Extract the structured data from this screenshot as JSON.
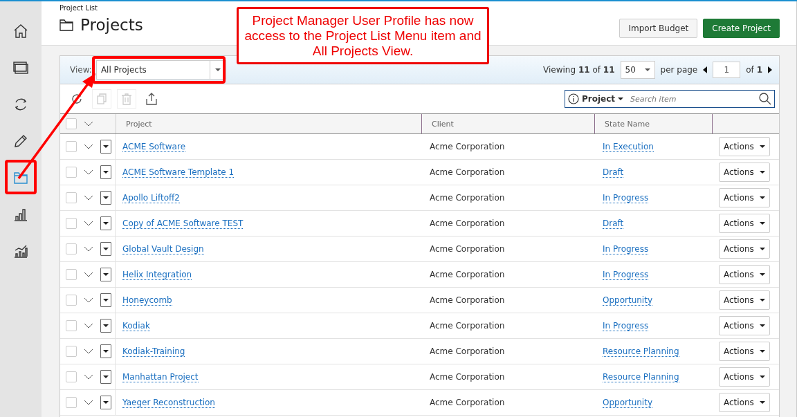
{
  "sidebar": {
    "items": [
      {
        "kind": "home",
        "selected": false
      },
      {
        "kind": "windows",
        "selected": false
      },
      {
        "kind": "sync",
        "selected": false
      },
      {
        "kind": "pencil",
        "selected": false
      },
      {
        "kind": "folder",
        "selected": true
      },
      {
        "kind": "bars",
        "selected": false
      },
      {
        "kind": "trend",
        "selected": false
      }
    ]
  },
  "breadcrumb": "Project List",
  "title": "Projects",
  "header_buttons": [
    {
      "label": "Import Budget",
      "kind": "secondary"
    },
    {
      "label": "Create Project",
      "kind": "primary"
    }
  ],
  "view": {
    "label": "View:",
    "value": "All Projects"
  },
  "pagination": {
    "viewing": "Viewing **11** of **11**",
    "per_page_value": "50",
    "per_page_label": "per page",
    "page": "1",
    "of": "of **1**"
  },
  "toolbar": [
    {
      "kind": "refresh",
      "disabled": false
    },
    {
      "kind": "copy",
      "disabled": true
    },
    {
      "kind": "delete",
      "disabled": true
    },
    {
      "kind": "export",
      "disabled": false
    }
  ],
  "search": {
    "field": "Project",
    "placeholder": "Search item"
  },
  "table": {
    "select_all_checked": false,
    "columns": [
      "Project",
      "Client",
      "State Name"
    ],
    "rows": [
      {
        "project": "ACME Software",
        "client": "Acme Corporation",
        "state": "In Execution",
        "action": "Actions",
        "checked": false
      },
      {
        "project": "ACME Software Template 1",
        "client": "Acme Corporation",
        "state": "Draft",
        "action": "Actions",
        "checked": false
      },
      {
        "project": "Apollo Liftoff2",
        "client": "Acme Corporation",
        "state": "In Progress",
        "action": "Actions",
        "checked": false
      },
      {
        "project": "Copy of ACME Software TEST",
        "client": "Acme Corporation",
        "state": "Draft",
        "action": "Actions",
        "checked": false
      },
      {
        "project": "Global Vault Design",
        "client": "Acme Corporation",
        "state": "In Progress",
        "action": "Actions",
        "checked": false
      },
      {
        "project": "Helix Integration",
        "client": "Acme Corporation",
        "state": "In Progress",
        "action": "Actions",
        "checked": false
      },
      {
        "project": "Honeycomb",
        "client": "Acme Corporation",
        "state": "Opportunity",
        "action": "Actions",
        "checked": false
      },
      {
        "project": "Kodiak",
        "client": "Acme Corporation",
        "state": "In Progress",
        "action": "Actions",
        "checked": false
      },
      {
        "project": "Kodiak-Training",
        "client": "Acme Corporation",
        "state": "Resource Planning",
        "action": "Actions",
        "checked": false
      },
      {
        "project": "Manhattan Project",
        "client": "Acme Corporation",
        "state": "Resource Planning",
        "action": "Actions",
        "checked": false
      },
      {
        "project": "Yaeger Reconstruction",
        "client": "Acme Corporation",
        "state": "Opportunity",
        "action": "Actions",
        "checked": false
      }
    ]
  },
  "annotation": "Project Manager User Profile has now access to the Project List Menu item and All Projects View."
}
